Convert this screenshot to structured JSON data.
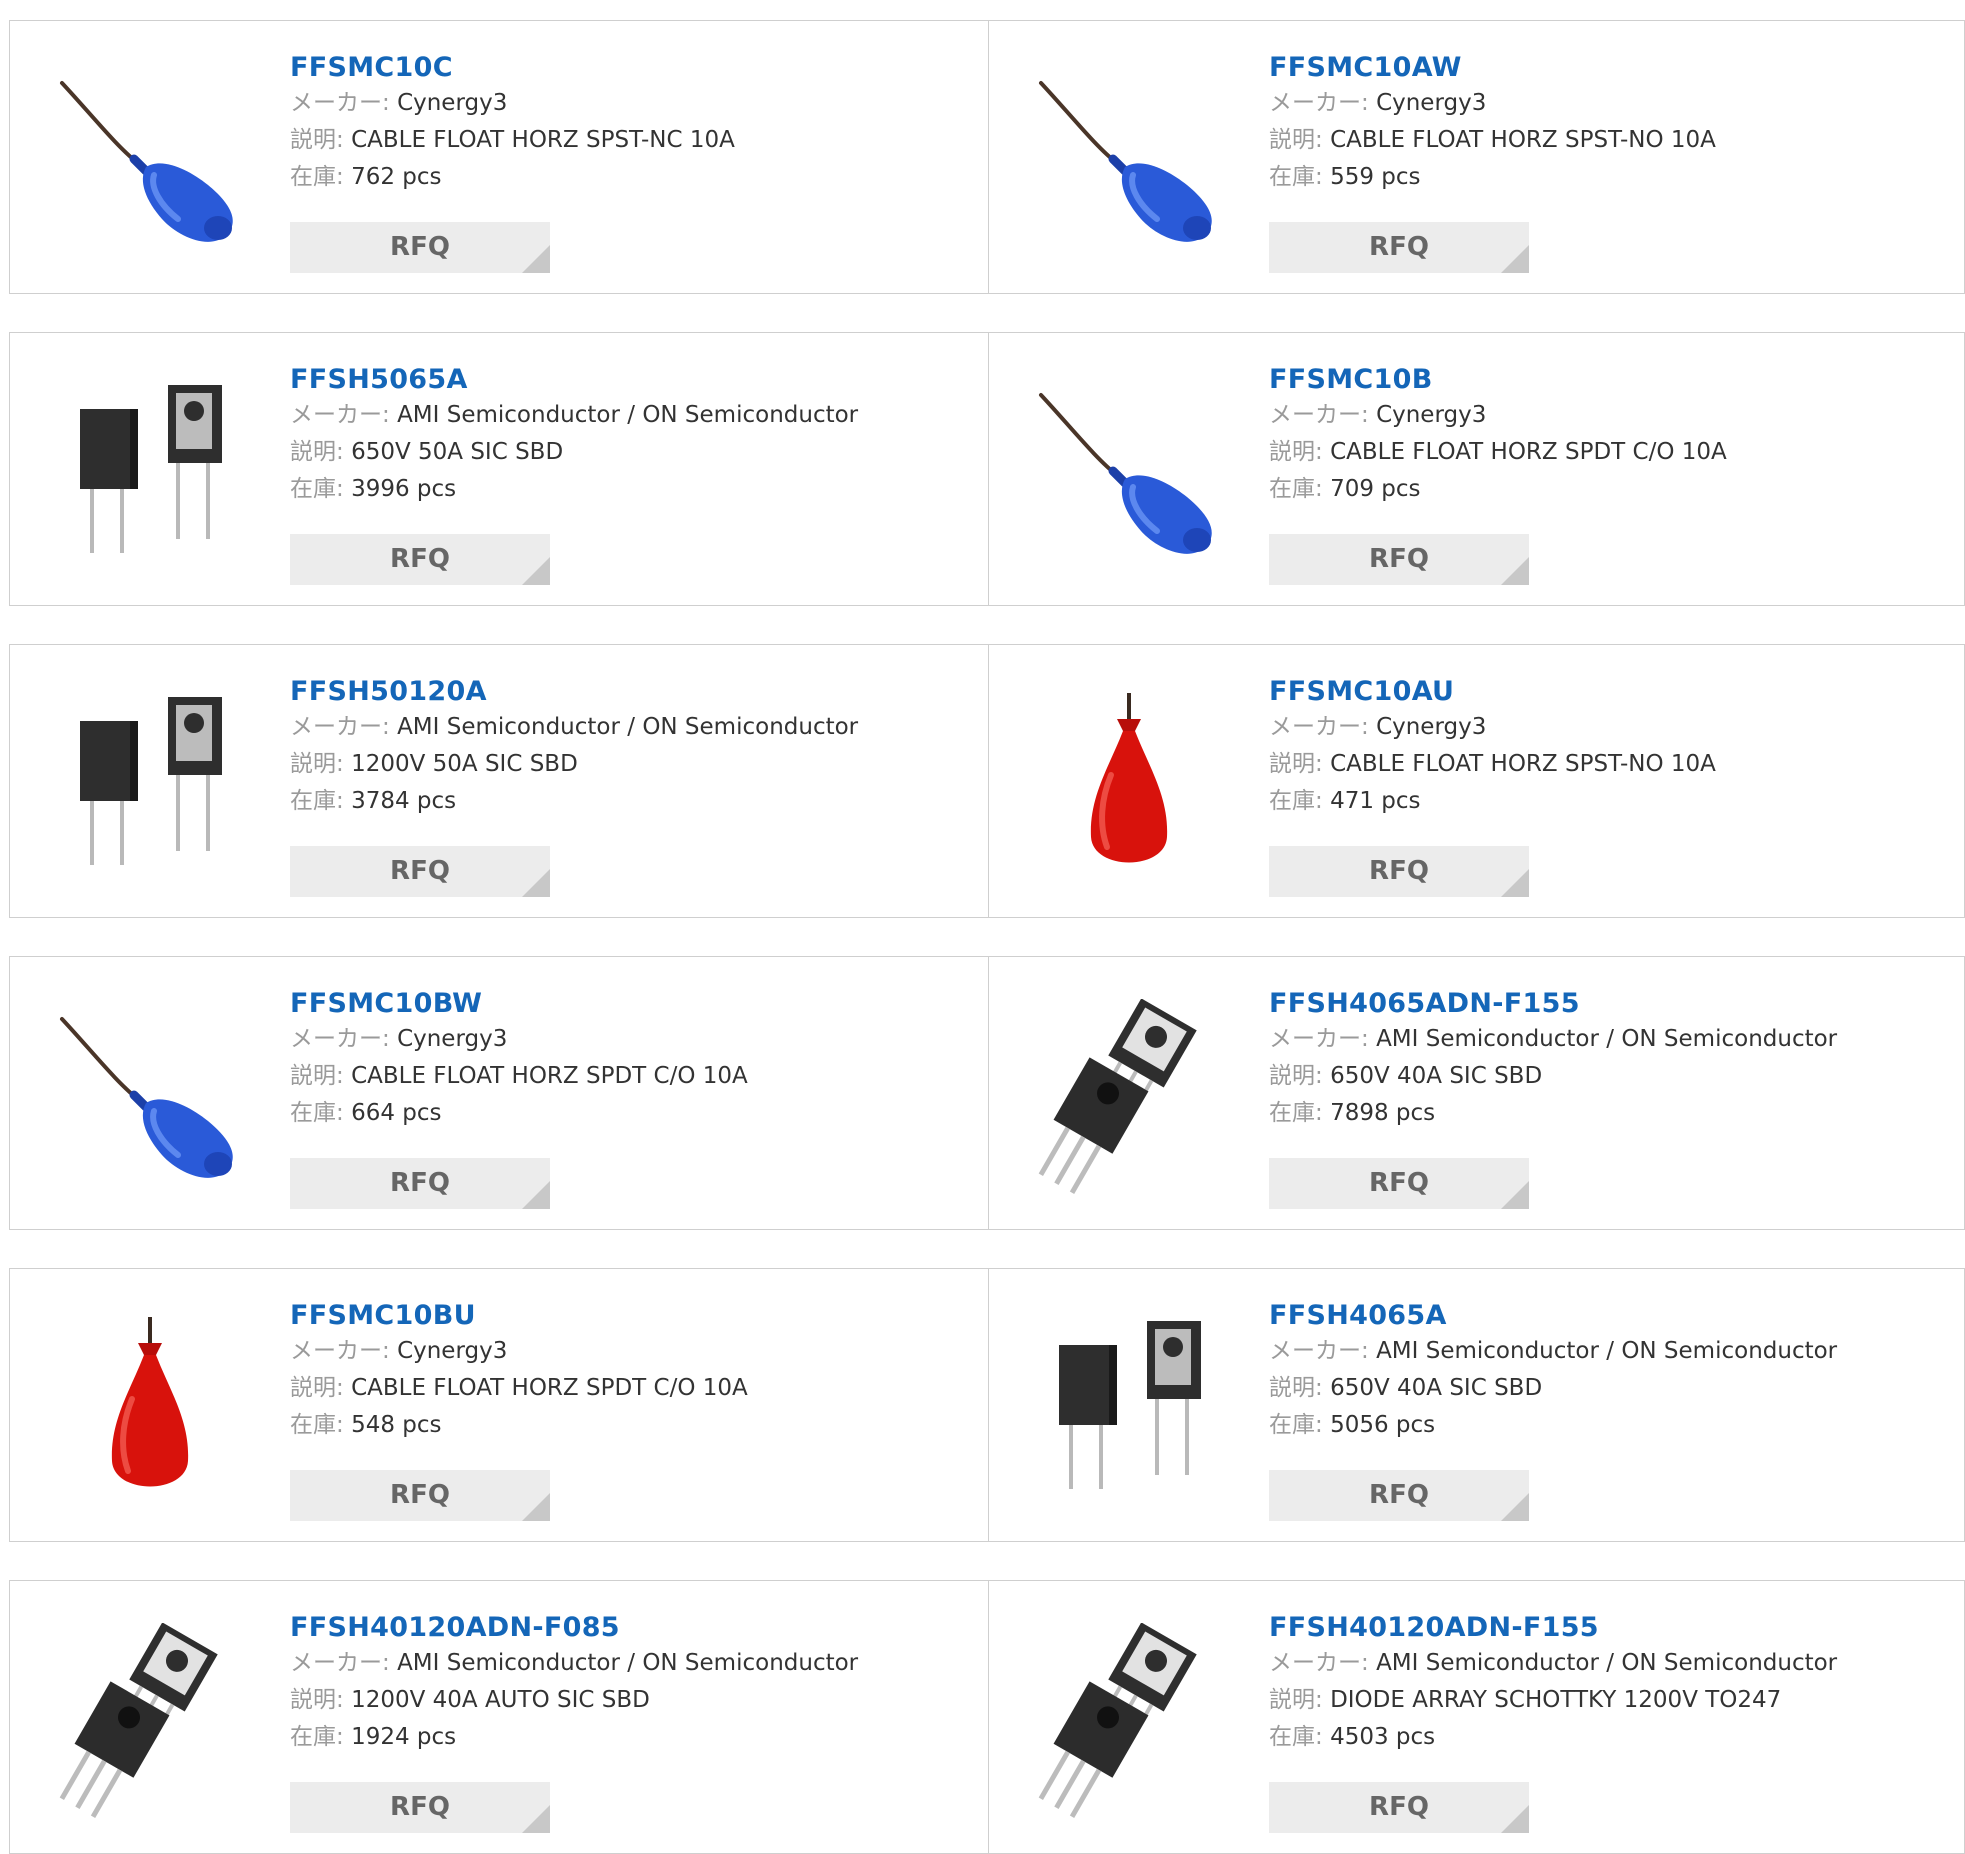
{
  "labels": {
    "manufacturer": "メーカー:",
    "description": "説明:",
    "stock": "在庫:",
    "rfq": "RFQ"
  },
  "products": [
    {
      "part": "FFSMC10C",
      "manufacturer": "Cynergy3",
      "description": "CABLE FLOAT HORZ SPST-NC 10A",
      "stock": "762 pcs",
      "image": "blue-float-switch"
    },
    {
      "part": "FFSMC10AW",
      "manufacturer": "Cynergy3",
      "description": "CABLE FLOAT HORZ SPST-NO 10A",
      "stock": "559 pcs",
      "image": "blue-float-switch"
    },
    {
      "part": "FFSH5065A",
      "manufacturer": "AMI Semiconductor / ON Semiconductor",
      "description": "650V 50A SIC SBD",
      "stock": "3996 pcs",
      "image": "to247-2-lead-diode"
    },
    {
      "part": "FFSMC10B",
      "manufacturer": "Cynergy3",
      "description": "CABLE FLOAT HORZ SPDT C/O 10A",
      "stock": "709 pcs",
      "image": "blue-float-switch"
    },
    {
      "part": "FFSH50120A",
      "manufacturer": "AMI Semiconductor / ON Semiconductor",
      "description": "1200V 50A SIC SBD",
      "stock": "3784 pcs",
      "image": "to247-2-lead-diode"
    },
    {
      "part": "FFSMC10AU",
      "manufacturer": "Cynergy3",
      "description": "CABLE FLOAT HORZ SPST-NO 10A",
      "stock": "471 pcs",
      "image": "red-float-switch"
    },
    {
      "part": "FFSMC10BW",
      "manufacturer": "Cynergy3",
      "description": "CABLE FLOAT HORZ SPDT C/O 10A",
      "stock": "664 pcs",
      "image": "blue-float-switch"
    },
    {
      "part": "FFSH4065ADN-F155",
      "manufacturer": "AMI Semiconductor / ON Semiconductor",
      "description": "650V 40A SIC SBD",
      "stock": "7898 pcs",
      "image": "to247-3-lead-package"
    },
    {
      "part": "FFSMC10BU",
      "manufacturer": "Cynergy3",
      "description": "CABLE FLOAT HORZ SPDT C/O 10A",
      "stock": "548 pcs",
      "image": "red-float-switch"
    },
    {
      "part": "FFSH4065A",
      "manufacturer": "AMI Semiconductor / ON Semiconductor",
      "description": "650V 40A SIC SBD",
      "stock": "5056 pcs",
      "image": "to247-2-lead-diode"
    },
    {
      "part": "FFSH40120ADN-F085",
      "manufacturer": "AMI Semiconductor / ON Semiconductor",
      "description": "1200V 40A AUTO SIC SBD",
      "stock": "1924 pcs",
      "image": "to247-3-lead-package"
    },
    {
      "part": "FFSH40120ADN-F155",
      "manufacturer": "AMI Semiconductor / ON Semiconductor",
      "description": "DIODE ARRAY SCHOTTKY 1200V TO247",
      "stock": "4503 pcs",
      "image": "to247-3-lead-package"
    }
  ],
  "colors": {
    "part_link": "#1466b8",
    "label": "#9a9a9a",
    "rfq_bg": "#ececec",
    "border": "#cfcfcf",
    "float_blue": "#2a5ad8",
    "float_red": "#d8120c"
  }
}
